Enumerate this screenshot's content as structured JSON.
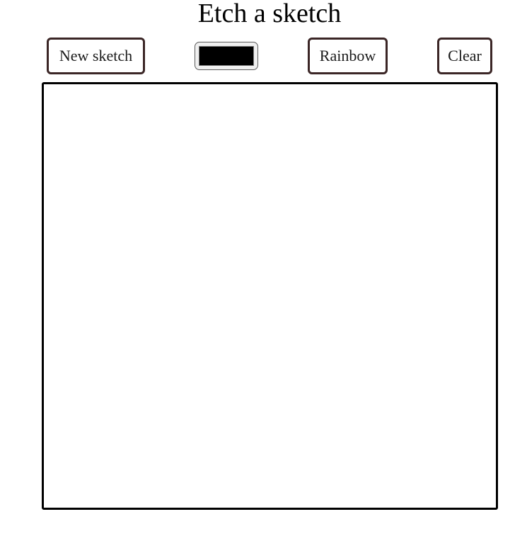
{
  "app": {
    "title": "Etch a sketch"
  },
  "toolbar": {
    "new_sketch_label": "New sketch",
    "rainbow_label": "Rainbow",
    "clear_label": "Clear",
    "color_picker": {
      "value": "#000000"
    }
  },
  "colors": {
    "button_border": "#3b2626",
    "canvas_border": "#000000",
    "background": "#ffffff"
  }
}
